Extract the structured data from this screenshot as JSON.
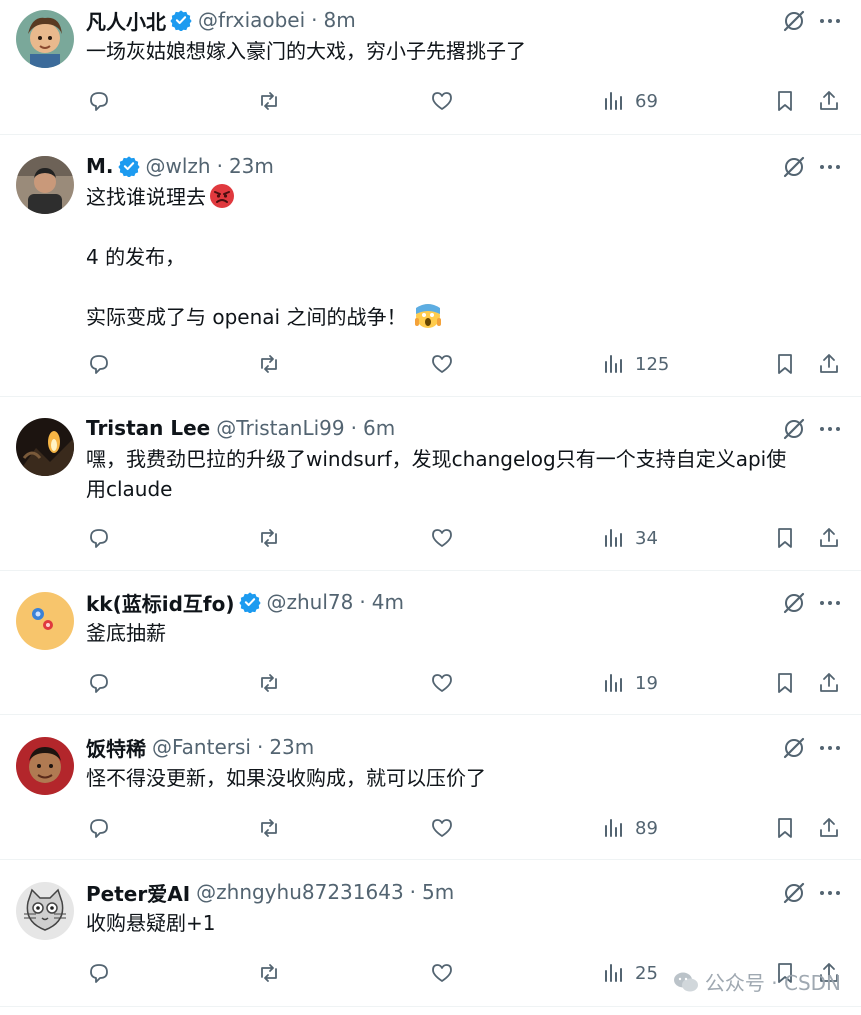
{
  "tweets": [
    {
      "name": "凡人小北",
      "verified": true,
      "handle": "@frxiaobei",
      "time": "8m",
      "text": [
        "一场灰姑娘想嫁入豪门的大戏，穷小子先撂挑子了"
      ],
      "views": "69",
      "avatar": "avatar-1"
    },
    {
      "name": "M.",
      "verified": true,
      "handle": "@wlzh",
      "time": "23m",
      "text": [
        "这找谁说理去",
        "",
        "4 的发布，",
        "",
        "实际变成了与 openai 之间的战争！"
      ],
      "views": "125",
      "avatar": "avatar-2"
    },
    {
      "name": "Tristan Lee",
      "verified": false,
      "handle": "@TristanLi99",
      "time": "6m",
      "text": [
        "嘿，我费劲巴拉的升级了windsurf，发现changelog只有一个支持自定义api使",
        "用claude"
      ],
      "views": "34",
      "avatar": "avatar-3"
    },
    {
      "name": "kk(蓝标id互fo)",
      "verified": true,
      "handle": "@zhul78",
      "time": "4m",
      "text": [
        "釜底抽薪"
      ],
      "views": "19",
      "avatar": "avatar-4"
    },
    {
      "name": "饭特稀",
      "verified": false,
      "handle": "@Fantersi",
      "time": "23m",
      "text": [
        "怪不得没更新，如果没收购成，就可以压价了"
      ],
      "views": "89",
      "avatar": "avatar-5"
    },
    {
      "name": "Peter爱AI",
      "verified": false,
      "handle": "@zhngyhu87231643",
      "time": "5m",
      "text": [
        "收购悬疑剧+1"
      ],
      "views": "25",
      "avatar": "avatar-6"
    }
  ],
  "separator": "·",
  "watermark": {
    "text": "公众号 · CSDN"
  },
  "colors": {
    "verified": "#1d9bf0",
    "secondary_text": "#536471",
    "primary_text": "#0f1419"
  }
}
